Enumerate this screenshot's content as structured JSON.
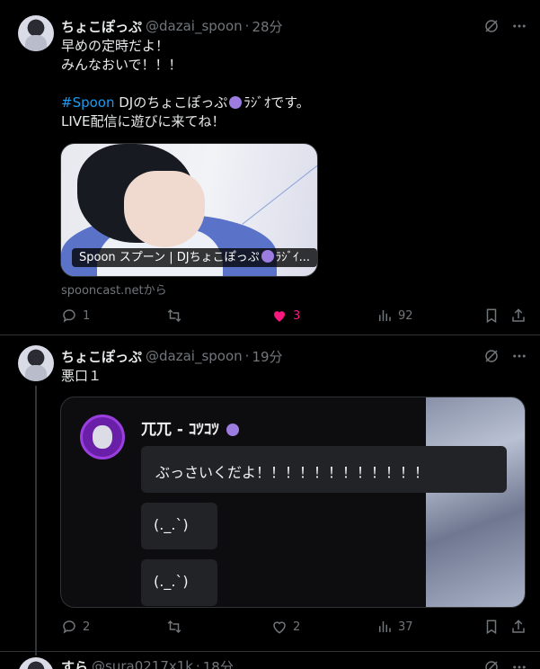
{
  "tweets": [
    {
      "name": "ちょこぽっぷ",
      "handle": "@dazai_spoon",
      "time": "28分",
      "lines": [
        "早めの定時だよ！",
        "みんなおいで！！！",
        "",
        "#Spoon",
        " DJのちょこぽっぷ",
        "ﾗｼﾞｵです。",
        "LIVE配信に遊びに来てね！"
      ],
      "card_label": "Spoon スプーン | DJちょこぽっぷ",
      "card_label_tail": "ﾗｼﾞｲ...",
      "source": "spooncast.netから",
      "replies": "1",
      "retweets": "",
      "likes": "3",
      "views": "92"
    },
    {
      "name": "ちょこぽっぷ",
      "handle": "@dazai_spoon",
      "time": "19分",
      "text": "悪口１",
      "quote": {
        "name": "兀兀 - ｺﾂｺﾂ",
        "messages": [
          "ぶっさいくだよ！！！！！！！！！！！！",
          "(._.`)",
          "(._.`)"
        ]
      },
      "replies": "2",
      "retweets": "",
      "likes": "2",
      "views": "37"
    },
    {
      "name": "すら",
      "handle": "@sura0217x1k",
      "time": "18分"
    }
  ],
  "colors": {
    "background": "#000000",
    "text": "#e7e9ea",
    "muted": "#71767b",
    "link": "#1d9bf0",
    "like": "#f91880"
  }
}
